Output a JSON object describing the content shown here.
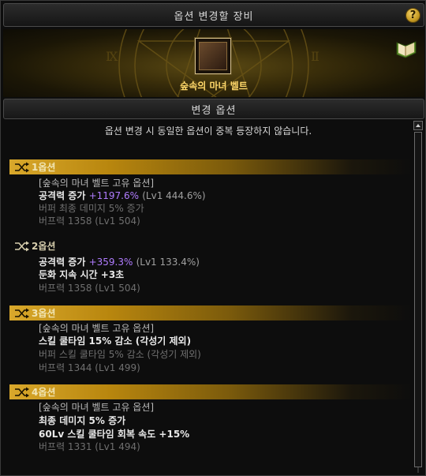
{
  "window": {
    "title": "옵션 변경할 장비",
    "help_label": "?"
  },
  "item": {
    "name": "숲속의 마녀 벨트",
    "icon": "belt-icon"
  },
  "section": {
    "title": "변경 옵션"
  },
  "notice": "옵션 변경 시 동일한 옵션이 중복 등장하지 않습니다.",
  "options": [
    {
      "label": "1옵션",
      "highlighted": true,
      "lines": [
        {
          "type": "unique",
          "text": "[숲속의 마녀 벨트 고유 옵션]"
        },
        {
          "type": "main",
          "text": "공격력 증가",
          "value": "+1197.6%",
          "lv": "(Lv1 444.6%)"
        },
        {
          "type": "dim",
          "text": "버퍼 최종 데미지 5% 증가"
        },
        {
          "type": "dim",
          "text": "버프력 1358 (Lv1 504)"
        }
      ]
    },
    {
      "label": "2옵션",
      "highlighted": false,
      "lines": [
        {
          "type": "main",
          "text": "공격력 증가",
          "value": "+359.3%",
          "lv": "(Lv1 133.4%)"
        },
        {
          "type": "main",
          "text": "둔화 지속 시간 +3초"
        },
        {
          "type": "dim",
          "text": "버프력 1358 (Lv1 504)"
        }
      ]
    },
    {
      "label": "3옵션",
      "highlighted": true,
      "lines": [
        {
          "type": "unique",
          "text": "[숲속의 마녀 벨트 고유 옵션]"
        },
        {
          "type": "main",
          "text": "스킬 쿨타임 15% 감소 (각성기 제외)"
        },
        {
          "type": "dim",
          "text": "버퍼 스킬 쿨타임 5% 감소 (각성기 제외)"
        },
        {
          "type": "dim",
          "text": "버프력 1344 (Lv1 499)"
        }
      ]
    },
    {
      "label": "4옵션",
      "highlighted": true,
      "lines": [
        {
          "type": "unique",
          "text": "[숲속의 마녀 벨트 고유 옵션]"
        },
        {
          "type": "main",
          "text": "최종 데미지 5% 증가"
        },
        {
          "type": "main",
          "text": "60Lv 스킬 쿨타임 회복 속도 +15%"
        },
        {
          "type": "dim",
          "text": "버프력 1331 (Lv1 494)"
        }
      ]
    }
  ],
  "colors": {
    "gold_accent": "#d9a82b",
    "item_name": "#ffd86a",
    "value_highlight": "#b07cff"
  }
}
